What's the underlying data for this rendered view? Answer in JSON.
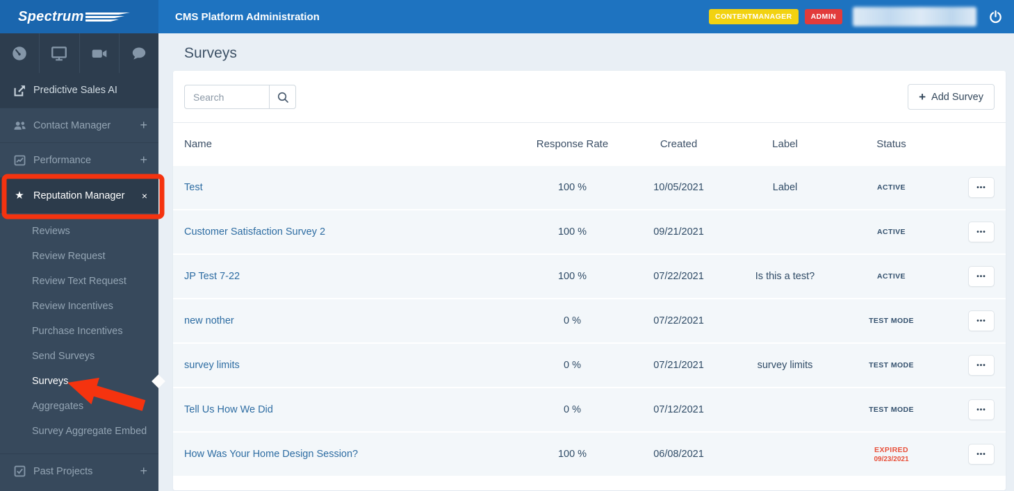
{
  "header": {
    "logo_text": "Spectrum",
    "title": "CMS Platform Administration",
    "badges": {
      "role1": "CONTENTMANAGER",
      "role2": "ADMIN"
    },
    "badge_colors": {
      "role1": "#f2d211",
      "role2": "#e23b3b"
    },
    "power_icon": "power-icon"
  },
  "sidebar": {
    "icon_bar": [
      "gauge-icon",
      "monitor-icon",
      "video-camera-icon",
      "chat-bubble-icon"
    ],
    "items": [
      {
        "label": "Predictive Sales AI",
        "icon": "external-link-square-icon",
        "expand": ""
      },
      {
        "label": "Contact Manager",
        "icon": "users-icon",
        "expand": "+"
      },
      {
        "label": "Performance",
        "icon": "chart-line-icon",
        "expand": "+"
      },
      {
        "label": "Reputation Manager",
        "icon": "star-icon",
        "expand": "×",
        "active": true
      }
    ],
    "submenu": [
      "Reviews",
      "Review Request",
      "Review Text Request",
      "Review Incentives",
      "Purchase Incentives",
      "Send Surveys",
      "Surveys",
      "Aggregates",
      "Survey Aggregate Embed"
    ],
    "active_submenu_index": 6,
    "past_projects": {
      "label": "Past Projects",
      "icon": "check-square-icon",
      "expand": "+"
    }
  },
  "main": {
    "page_title": "Surveys",
    "search": {
      "placeholder": "Search"
    },
    "add_button": {
      "label": "Add Survey",
      "plus": "+"
    },
    "table": {
      "columns": {
        "name": "Name",
        "response_rate": "Response Rate",
        "created": "Created",
        "label": "Label",
        "status": "Status"
      },
      "rows": [
        {
          "name": "Test",
          "response_rate": "100 %",
          "created": "10/05/2021",
          "label": "Label",
          "status": "ACTIVE",
          "status_type": "active"
        },
        {
          "name": "Customer Satisfaction Survey 2",
          "response_rate": "100 %",
          "created": "09/21/2021",
          "label": "",
          "status": "ACTIVE",
          "status_type": "active"
        },
        {
          "name": "JP Test 7-22",
          "response_rate": "100 %",
          "created": "07/22/2021",
          "label": "Is this a test?",
          "status": "ACTIVE",
          "status_type": "active"
        },
        {
          "name": "new nother",
          "response_rate": "0 %",
          "created": "07/22/2021",
          "label": "",
          "status": "TEST MODE",
          "status_type": "test"
        },
        {
          "name": "survey limits",
          "response_rate": "0 %",
          "created": "07/21/2021",
          "label": "survey limits",
          "status": "TEST MODE",
          "status_type": "test"
        },
        {
          "name": "Tell Us How We Did",
          "response_rate": "0 %",
          "created": "07/12/2021",
          "label": "",
          "status": "TEST MODE",
          "status_type": "test"
        },
        {
          "name": "How Was Your Home Design Session?",
          "response_rate": "100 %",
          "created": "06/08/2021",
          "label": "",
          "status": "EXPIRED",
          "status_date": "09/23/2021",
          "status_type": "expired"
        }
      ],
      "row_actions_icon": "ellipsis-icon"
    }
  },
  "annotations": {
    "color": "#f5330f",
    "highlight_box_target": "Reputation Manager",
    "arrow_target": "Surveys"
  }
}
